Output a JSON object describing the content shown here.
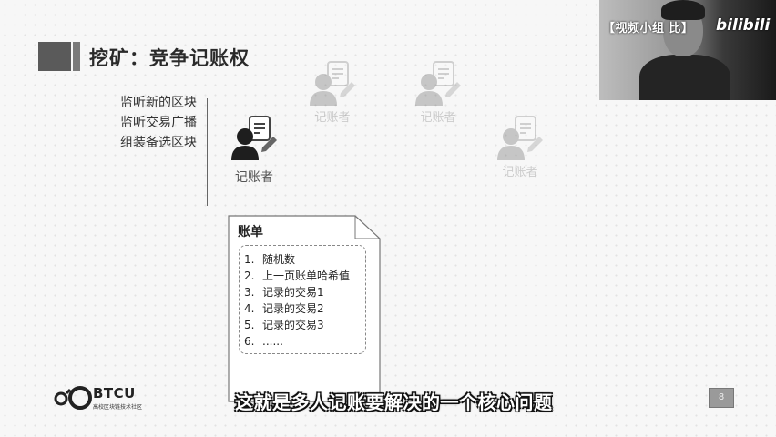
{
  "slide": {
    "title": "挖矿：竞争记账权",
    "tasks": [
      "监听新的区块",
      "监听交易广播",
      "组装备选区块"
    ],
    "accountants": [
      {
        "label": "记账者",
        "emphasis": "main"
      },
      {
        "label": "记账者",
        "emphasis": "faded"
      },
      {
        "label": "记账者",
        "emphasis": "faded"
      },
      {
        "label": "记账者",
        "emphasis": "faded"
      }
    ],
    "ledger": {
      "title": "账单",
      "items": [
        {
          "num": "1.",
          "text": "随机数"
        },
        {
          "num": "2.",
          "text": "上一页账单哈希值"
        },
        {
          "num": "3.",
          "text": "记录的交易1"
        },
        {
          "num": "4.",
          "text": "记录的交易2"
        },
        {
          "num": "5.",
          "text": "记录的交易3"
        },
        {
          "num": "6.",
          "text": "......"
        }
      ]
    },
    "page_number": "8"
  },
  "logo": {
    "brand": "BTCU",
    "sub": "高校区块链技术社区"
  },
  "subtitle": "这就是多人记账要解决的一个核心问题",
  "webcam": {
    "watermark": "【视频小组 比】",
    "platform": "bilibili"
  },
  "colors": {
    "background": "#f7f7f7",
    "title_block": "#5a5a5a",
    "accent_dark": "#2a2a2a"
  }
}
